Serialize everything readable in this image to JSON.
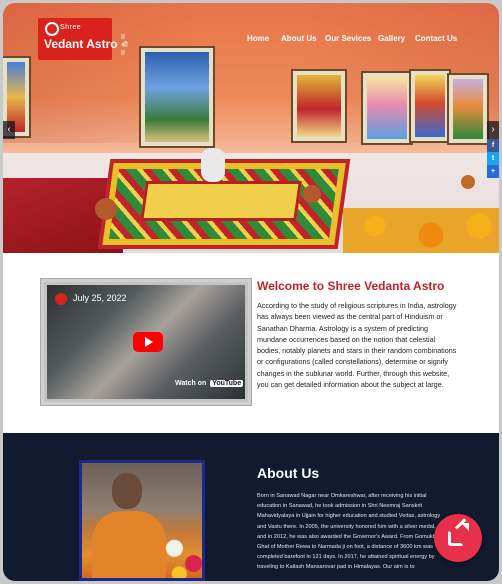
{
  "brand": {
    "logo_top": "II श्री II",
    "logo_small": "Shree",
    "logo_main": "Vedant Astro"
  },
  "nav": {
    "items": [
      {
        "label": "Home"
      },
      {
        "label": "About Us"
      },
      {
        "label": "Our Sevices"
      },
      {
        "label": "Gallery"
      },
      {
        "label": "Contact Us"
      }
    ]
  },
  "carousel": {
    "prev_icon": "chevron-left-icon",
    "next_icon": "chevron-right-icon"
  },
  "social": {
    "items": [
      {
        "icon": "facebook-icon",
        "glyph": "f",
        "color": "#3b5998"
      },
      {
        "icon": "twitter-icon",
        "glyph": "t",
        "color": "#1da1f2"
      },
      {
        "icon": "share-icon",
        "glyph": "+",
        "color": "#2b6bd6"
      }
    ]
  },
  "video": {
    "date": "July 25, 2022",
    "watch_on": "Watch on",
    "youtube": "YouTube"
  },
  "welcome": {
    "title": "Welcome to Shree Vedanta Astro",
    "body": "According to the study of religious scriptures in India, astrology has always been viewed as the central part of Hinduism or Sanathan Dharma. Astrology is a system of predicting mundane occurrences based on the notion that celestial bodies, notably planets and stars in their random combinations or configurations (called constellations), determine or signify changes in the sublunar world. Further, through this website, you can get detailed information about the subject at large."
  },
  "about": {
    "title": "About Us",
    "body": "Born in Sanawad Nagar near Omkareshwar, after receiving his initial education in Sanawad, he took admission in Shri Neemraj Sanskrit Mahavidyalaya in Ujjain for higher education and studied Vedas, astrology and Vastu there. In 2005, the university honored him with a silver medal, and in 2012, he was also awarded the Governor's Award. From Gomukh Ghat of Mother Rewa to Narmada ji on foot, a distance of 3600 km was completed barefoot in 121 days. In 2017, he attained spiritual energy by traveling to Kailash Mansarovar pad in Himalayas. Our aim is to"
  },
  "fab": {
    "icon": "external-link-icon",
    "color": "#e8304a"
  }
}
